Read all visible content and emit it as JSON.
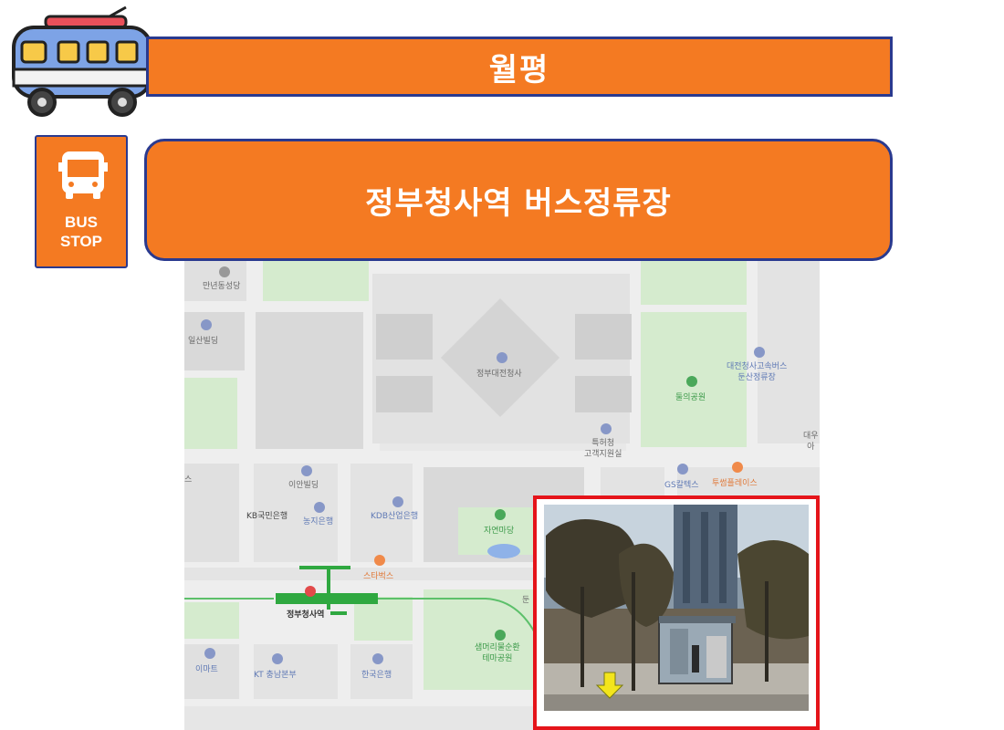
{
  "header": {
    "title": "월평"
  },
  "stop": {
    "name": "정부청사역 버스정류장"
  },
  "bus_stop_sign": {
    "line1": "BUS",
    "line2": "STOP",
    "icon": "bus-icon"
  },
  "colors": {
    "accent": "#f47a22",
    "border": "#2a3a8f",
    "photo_frame": "#e5141a"
  },
  "map": {
    "labels": {
      "manyeon": "만년동성당",
      "ilsan": "일산빌딩",
      "government": "정부대전청사",
      "terminal": "대전청사고속버스\n둔산정류장",
      "park": "둘의공원",
      "patent": "특허청\n고객지원실",
      "daewoo": "대우\n아",
      "ian": "이안빌딩",
      "kb": "KB국민은행",
      "nonghyup": "농지은행",
      "kdb": "KDB산업은행",
      "jayeon": "자연마당",
      "gs": "GS칼텍스",
      "twosome": "투썸플레이스",
      "starbucks": "스타벅스",
      "station": "정부청사역",
      "saemmeori": "샘머리물순환\n테마공원",
      "emart": "이마트",
      "kt": "KT 충남본부",
      "kepco": "한국은행",
      "left_edge": "스",
      "dun": "둔"
    }
  }
}
